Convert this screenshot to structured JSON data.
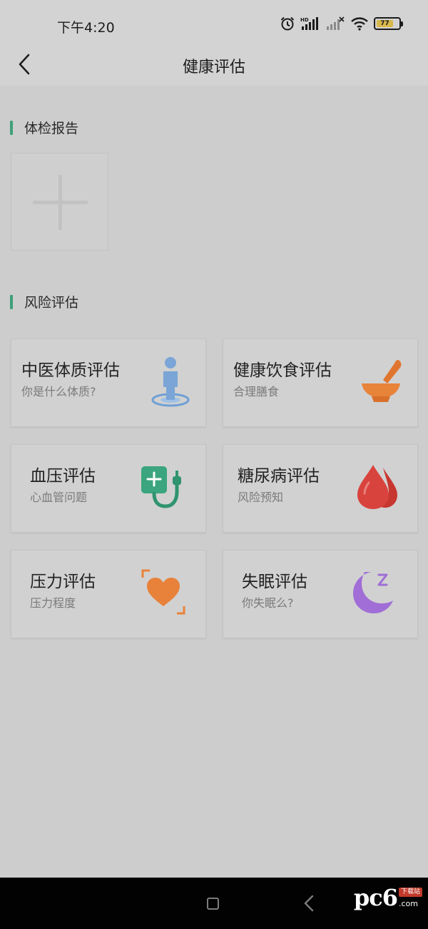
{
  "status_bar": {
    "time": "下午4:20",
    "battery": "77",
    "icons": [
      "alarm-icon",
      "hd-signal-icon",
      "no-signal-icon",
      "wifi-icon",
      "battery-icon"
    ]
  },
  "header": {
    "title": "健康评估",
    "back_icon": "back-arrow-icon"
  },
  "sections": {
    "report": {
      "title": "体检报告",
      "add_icon": "plus-icon"
    },
    "risk": {
      "title": "风险评估"
    }
  },
  "cards": [
    {
      "title": "中医体质评估",
      "subtitle": "你是什么体质?",
      "icon": "person-icon",
      "color": "#7aa5d6"
    },
    {
      "title": "健康饮食评估",
      "subtitle": "合理膳食",
      "icon": "mortar-bowl-icon",
      "color": "#e8833a"
    },
    {
      "title": "血压评估",
      "subtitle": "心血管问题",
      "icon": "blood-pressure-icon",
      "color": "#3aa57e"
    },
    {
      "title": "糖尿病评估",
      "subtitle": "风险预知",
      "icon": "blood-drop-icon",
      "color": "#d9433e"
    },
    {
      "title": "压力评估",
      "subtitle": "压力程度",
      "icon": "heart-frame-icon",
      "color": "#e8823a"
    },
    {
      "title": "失眠评估",
      "subtitle": "你失眠么?",
      "icon": "moon-sleep-icon",
      "color": "#a06ed6"
    }
  ],
  "nav": {
    "icons": [
      "recent-apps-icon",
      "back-icon"
    ],
    "watermark": {
      "text": "pc6",
      "badge": "下载站",
      "suffix": ".com"
    }
  }
}
